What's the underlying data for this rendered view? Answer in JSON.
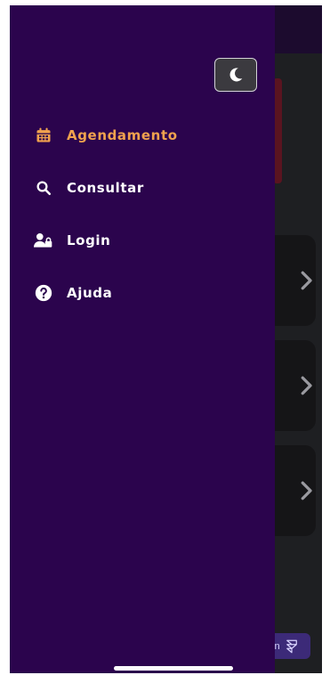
{
  "drawer": {
    "menu_items": [
      {
        "label": "Agendamento",
        "icon": "calendar-icon",
        "active": true
      },
      {
        "label": "Consultar",
        "icon": "search-icon",
        "active": false
      },
      {
        "label": "Login",
        "icon": "users-lock-icon",
        "active": false
      },
      {
        "label": "Ajuda",
        "icon": "help-circle-icon",
        "active": false
      }
    ],
    "theme_toggle_icon": "moon-icon"
  },
  "badge": {
    "text": "ilt in",
    "icon": "framer-logo-icon"
  },
  "colors": {
    "drawer_bg": "#2b044d",
    "active_text": "#f0a24e",
    "text": "#ffffff",
    "page_bg": "#1e1f22"
  }
}
